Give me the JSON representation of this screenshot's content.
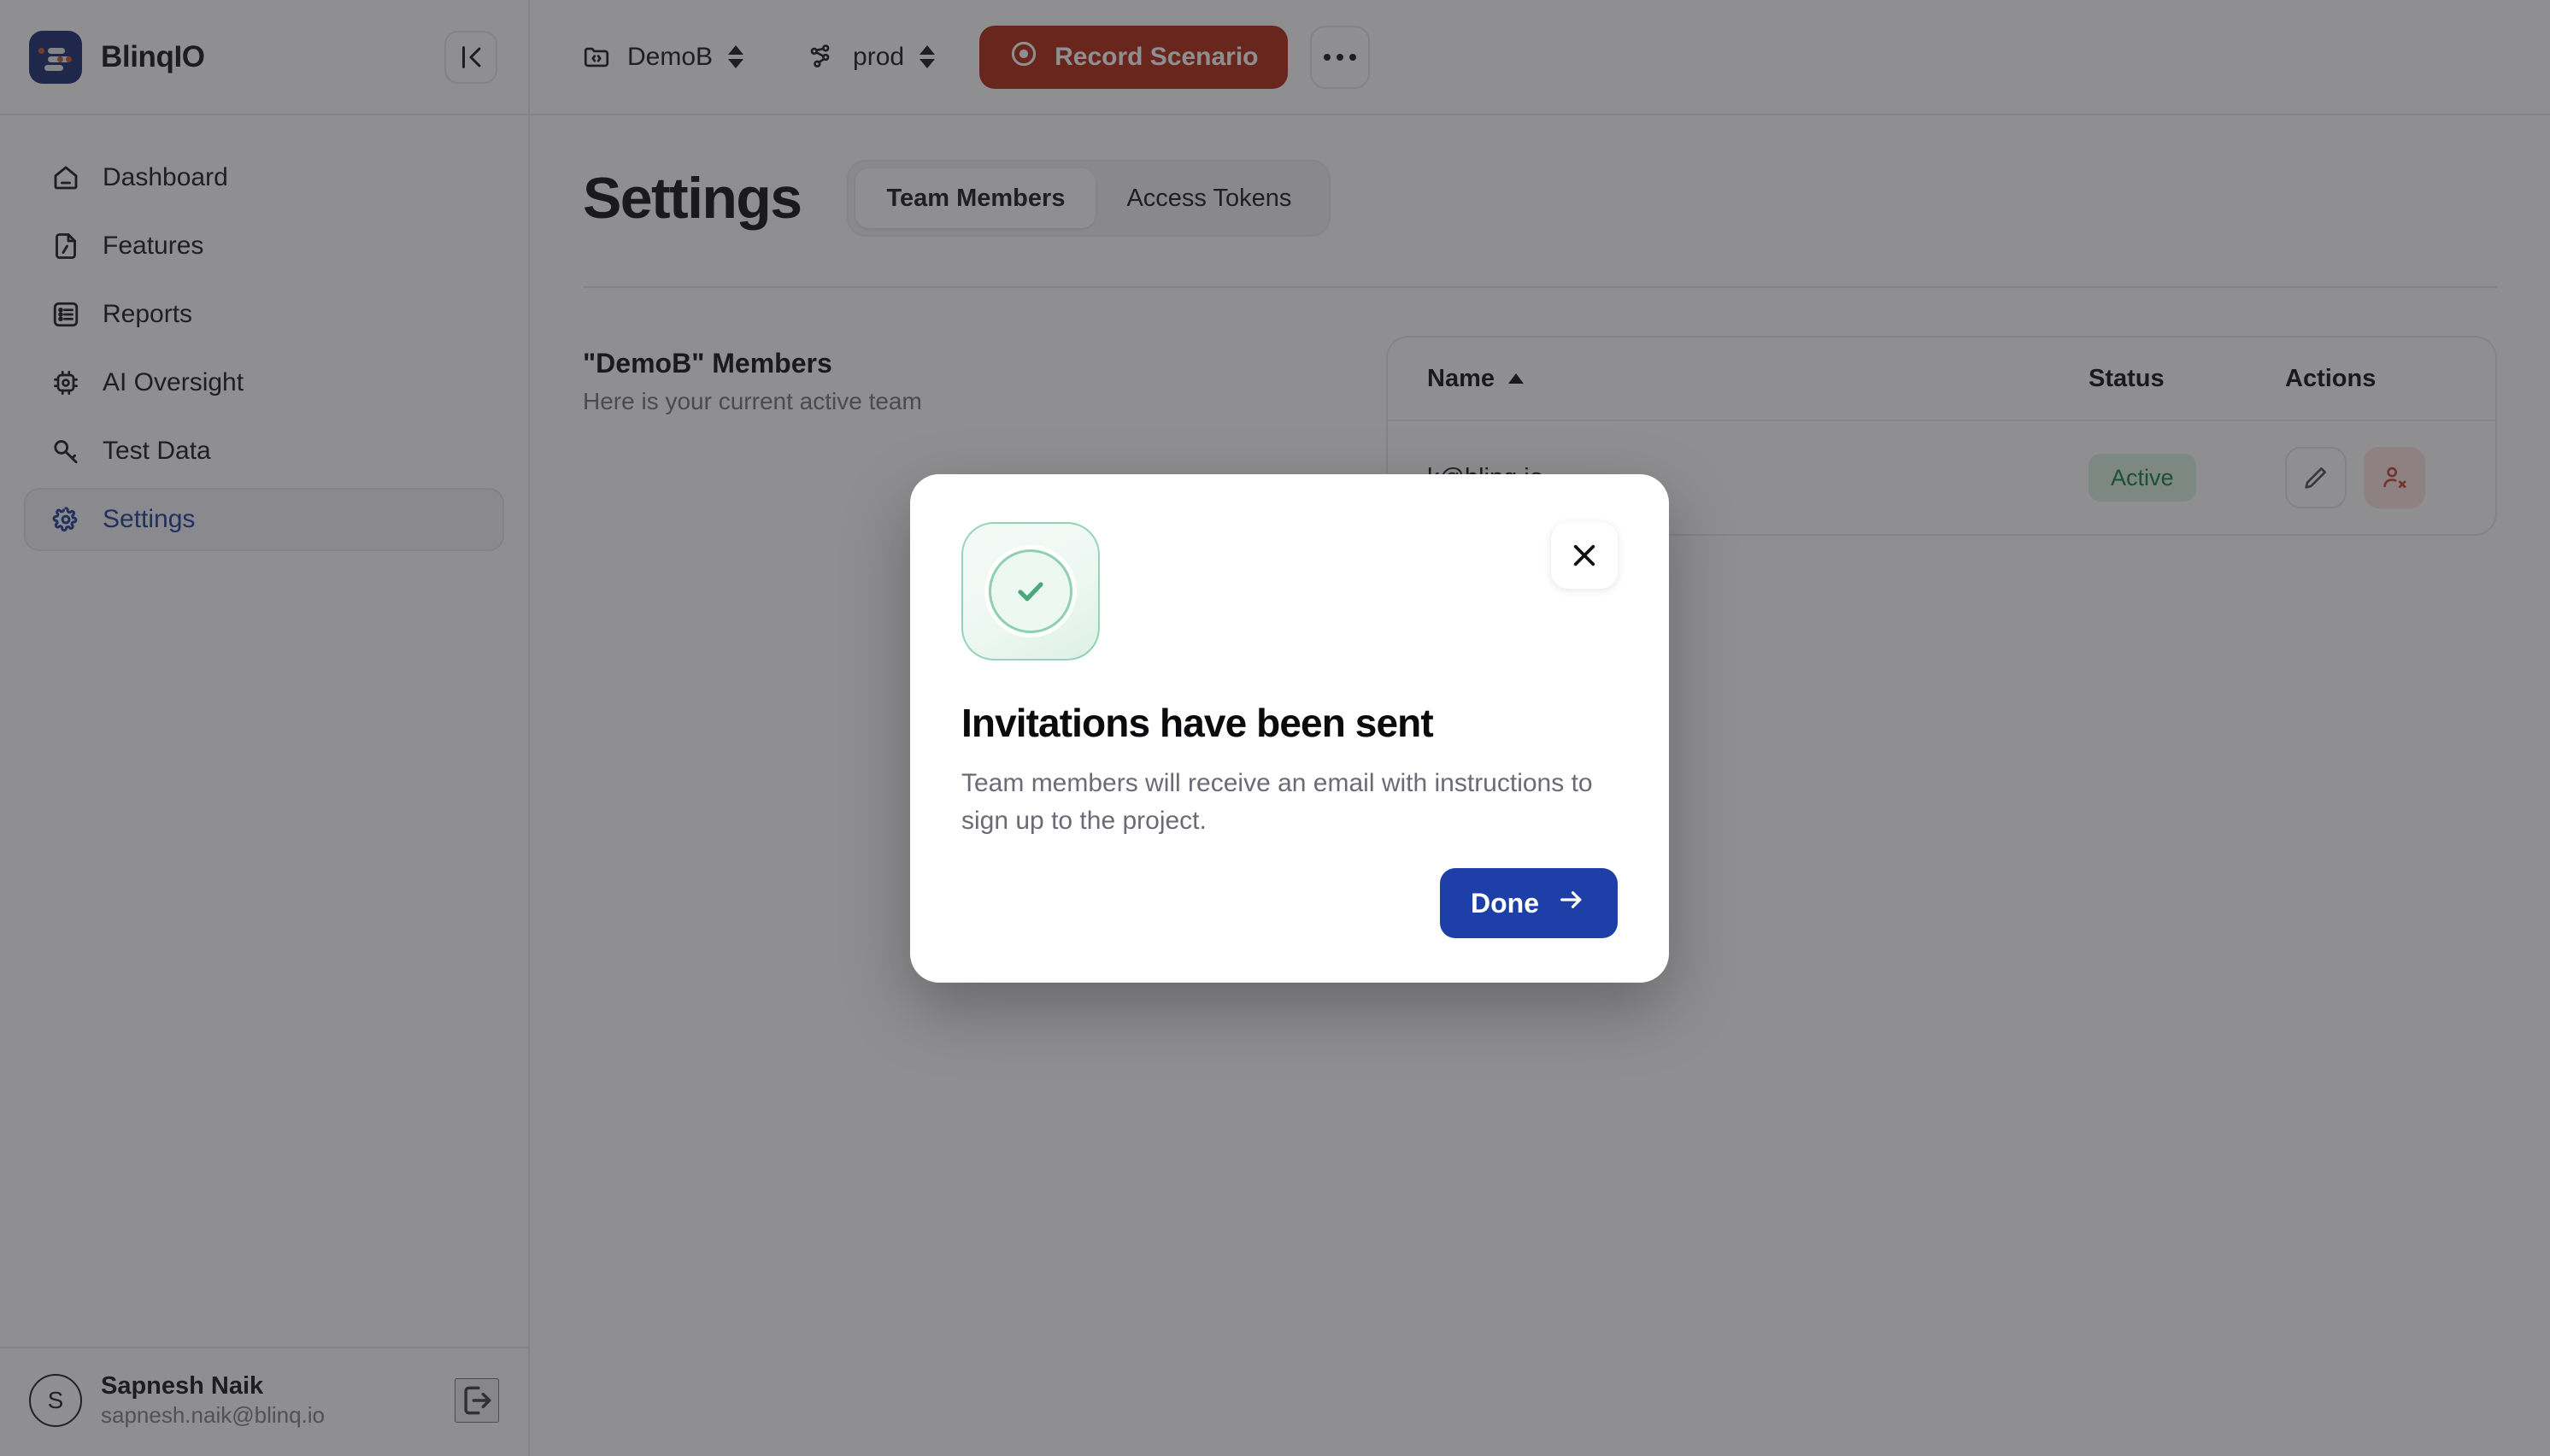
{
  "brand": {
    "name": "BlinqIO",
    "logo_icon": "blinqio-logo-icon"
  },
  "sidebar": {
    "collapse_icon": "collapse-panel-icon",
    "items": [
      {
        "label": "Dashboard",
        "icon": "home-icon",
        "active": false
      },
      {
        "label": "Features",
        "icon": "file-code-icon",
        "active": false
      },
      {
        "label": "Reports",
        "icon": "list-icon",
        "active": false
      },
      {
        "label": "AI Oversight",
        "icon": "chip-icon",
        "active": false
      },
      {
        "label": "Test Data",
        "icon": "key-icon",
        "active": false
      },
      {
        "label": "Settings",
        "icon": "gear-icon",
        "active": true
      }
    ],
    "footer": {
      "avatar_initial": "S",
      "user_name": "Sapnesh Naik",
      "user_email": "sapnesh.naik@blinq.io",
      "logout_icon": "logout-icon"
    }
  },
  "topbar": {
    "project_selector": {
      "value": "DemoB",
      "icon": "project-folder-icon"
    },
    "environment_selector": {
      "value": "prod",
      "icon": "environment-graph-icon"
    },
    "record_button": {
      "label": "Record Scenario",
      "icon": "record-circle-icon",
      "color": "#b0250e"
    },
    "more_button": {
      "icon": "more-horizontal-icon"
    }
  },
  "page": {
    "title": "Settings",
    "tabs": [
      {
        "label": "Team Members",
        "selected": true
      },
      {
        "label": "Access Tokens",
        "selected": false
      }
    ],
    "members_section": {
      "title": "\"DemoB\" Members",
      "subtitle": "Here is your current active team"
    },
    "table": {
      "columns": [
        "Name",
        "Status",
        "Actions"
      ],
      "sort_icon": "sort-ascending-icon",
      "rows": [
        {
          "name": "k@blinq.io",
          "status": "Active",
          "actions": [
            {
              "icon": "edit-pencil-icon",
              "variant": "default"
            },
            {
              "icon": "remove-user-icon",
              "variant": "danger"
            }
          ]
        }
      ]
    }
  },
  "modal": {
    "success_icon": "check-circle-icon",
    "close_icon": "close-x-icon",
    "title": "Invitations have been sent",
    "body": "Team members will receive an email with instructions to sign up to the project.",
    "primary_button": {
      "label": "Done",
      "icon": "arrow-right-icon",
      "color": "#1e3fa8"
    }
  }
}
